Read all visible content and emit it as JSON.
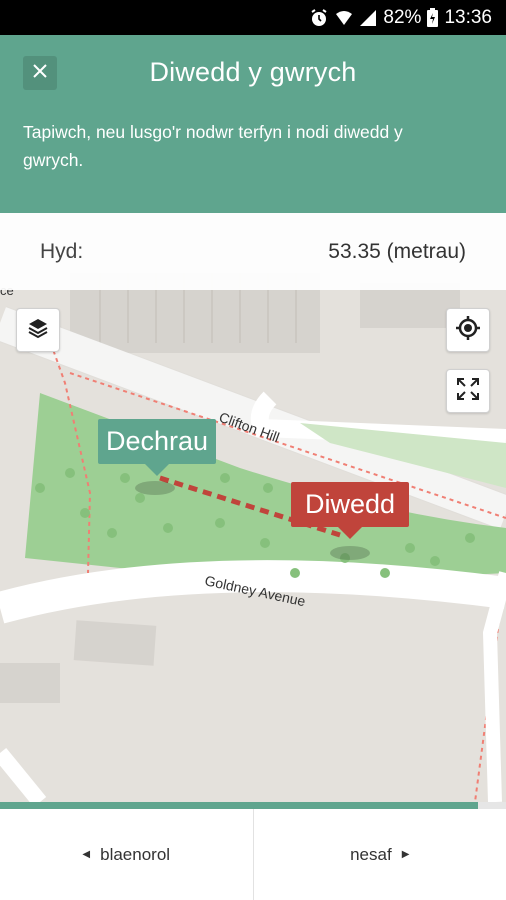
{
  "status_bar": {
    "battery": "82%",
    "time": "13:36"
  },
  "header": {
    "title": "Diwedd y gwrych",
    "instruction": "Tapiwch, neu lusgo'r nodwr terfyn i nodi diwedd y gwrych."
  },
  "length": {
    "label": "Hyd:",
    "value": "53.35 (metrau)"
  },
  "map": {
    "streets": [
      "Clifton Hill",
      "Goldney Avenue"
    ],
    "partial_label": "ce",
    "markers": {
      "start": "Dechrau",
      "end": "Diwedd"
    }
  },
  "progress": {
    "value": 0.945
  },
  "nav": {
    "prev": "blaenorol",
    "next": "nesaf"
  },
  "colors": {
    "accent": "#5fa58e",
    "end_marker": "#c0443b",
    "park": "#9dcf94"
  }
}
